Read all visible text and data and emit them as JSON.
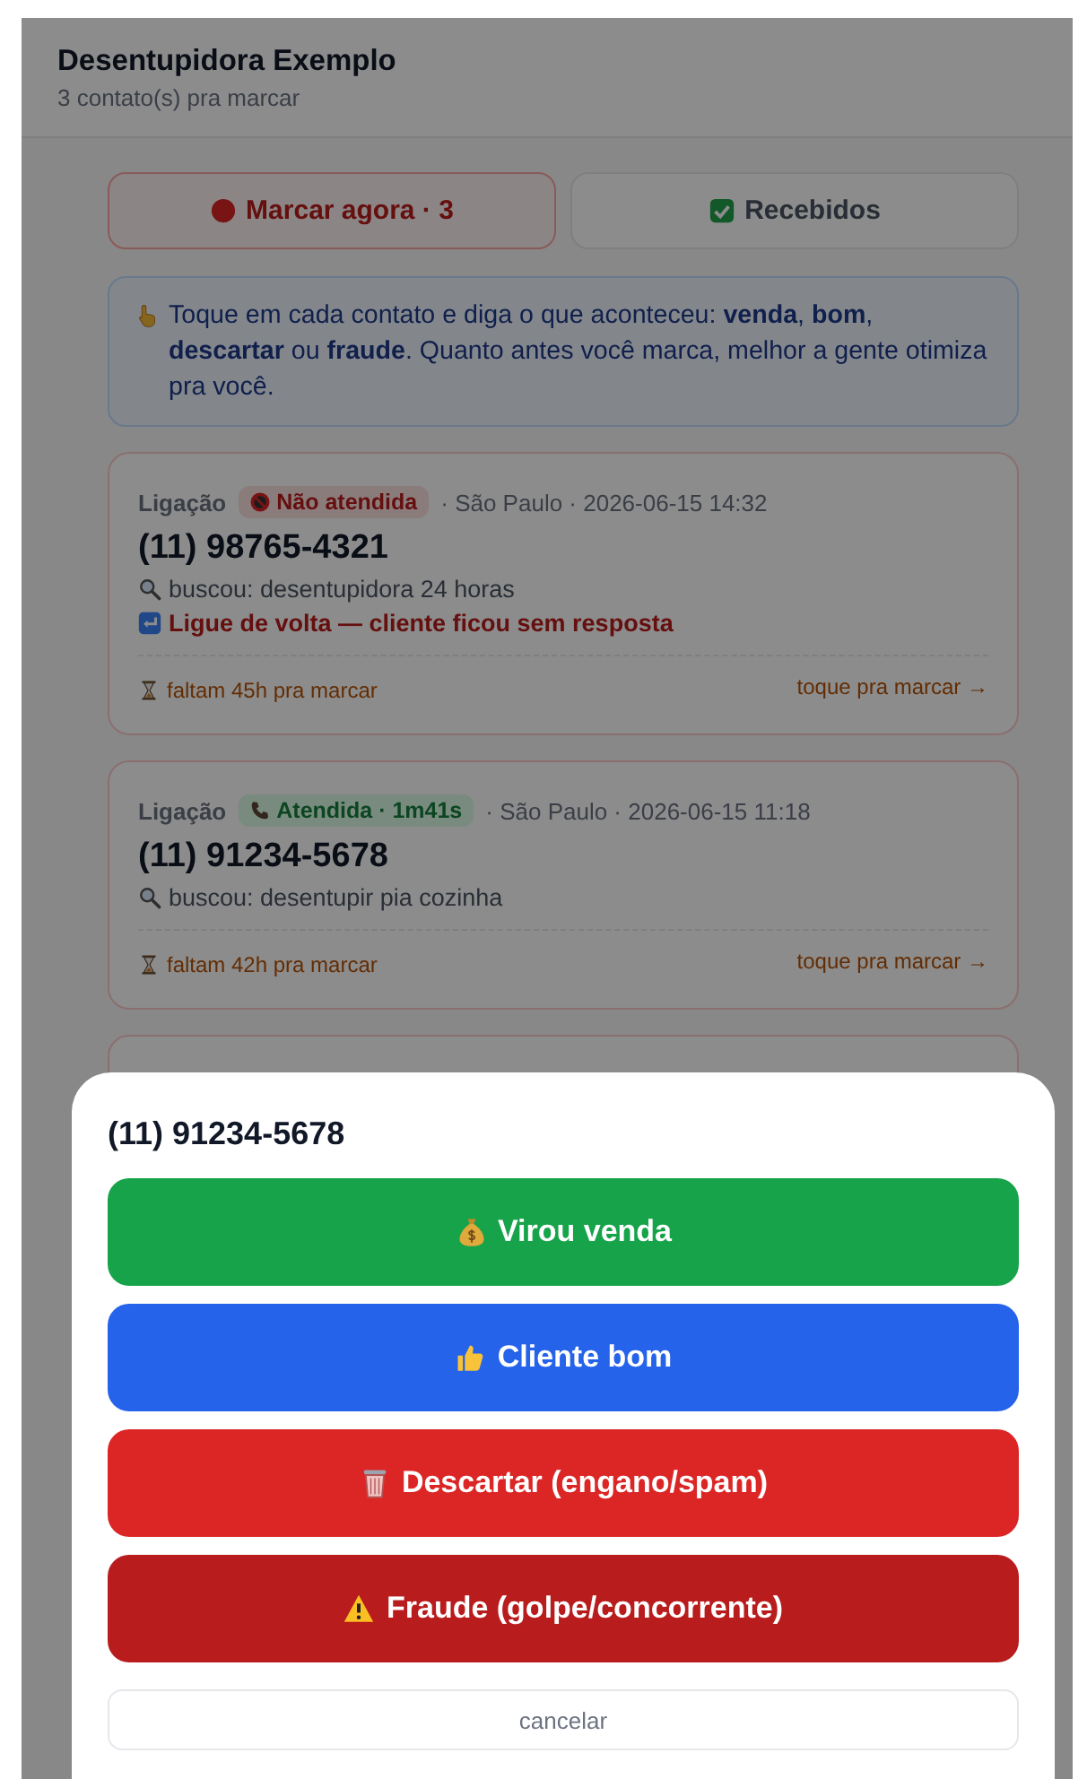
{
  "header": {
    "title": "Desentupidora Exemplo",
    "subtitle": "3 contato(s) pra marcar"
  },
  "tabs": [
    {
      "kind": "pending",
      "label": "Marcar agora · 3",
      "selected": true
    },
    {
      "kind": "received",
      "label": "Recebidos",
      "selected": false
    }
  ],
  "notice": {
    "text": "Toque em cada contato e diga o que aconteceu: **venda**, **bom**, **descartar** ou **fraude**. Quanto antes você marca, melhor a gente otimiza pra você."
  },
  "contacts": [
    {
      "type": "Ligação",
      "status": {
        "kind": "missed",
        "label": "Não atendida"
      },
      "meta": "· São Paulo · 2026-06-15 14:32",
      "phone": "(11) 98765-4321",
      "search": "buscou: desentupidora 24 horas",
      "alert": "Ligue de volta — cliente ficou sem resposta",
      "deadline": "faltam 45h pra marcar",
      "action": "toque pra marcar →"
    },
    {
      "type": "Ligação",
      "status": {
        "kind": "answered",
        "label": "Atendida · 1m41s"
      },
      "meta": "· São Paulo · 2026-06-15 11:18",
      "phone": "(11) 91234-5678",
      "search": "buscou: desentupir pia cozinha",
      "deadline": "faltam 42h pra marcar",
      "action": "toque pra marcar →"
    }
  ],
  "sheet": {
    "title": "(11) 91234-5678",
    "options": [
      {
        "kind": "sale",
        "label": "Virou venda"
      },
      {
        "kind": "good",
        "label": "Cliente bom"
      },
      {
        "kind": "discard",
        "label": "Descartar (engano/spam)"
      },
      {
        "kind": "fraud",
        "label": "Fraude (golpe/concorrente)"
      }
    ],
    "cancel": "cancelar"
  }
}
